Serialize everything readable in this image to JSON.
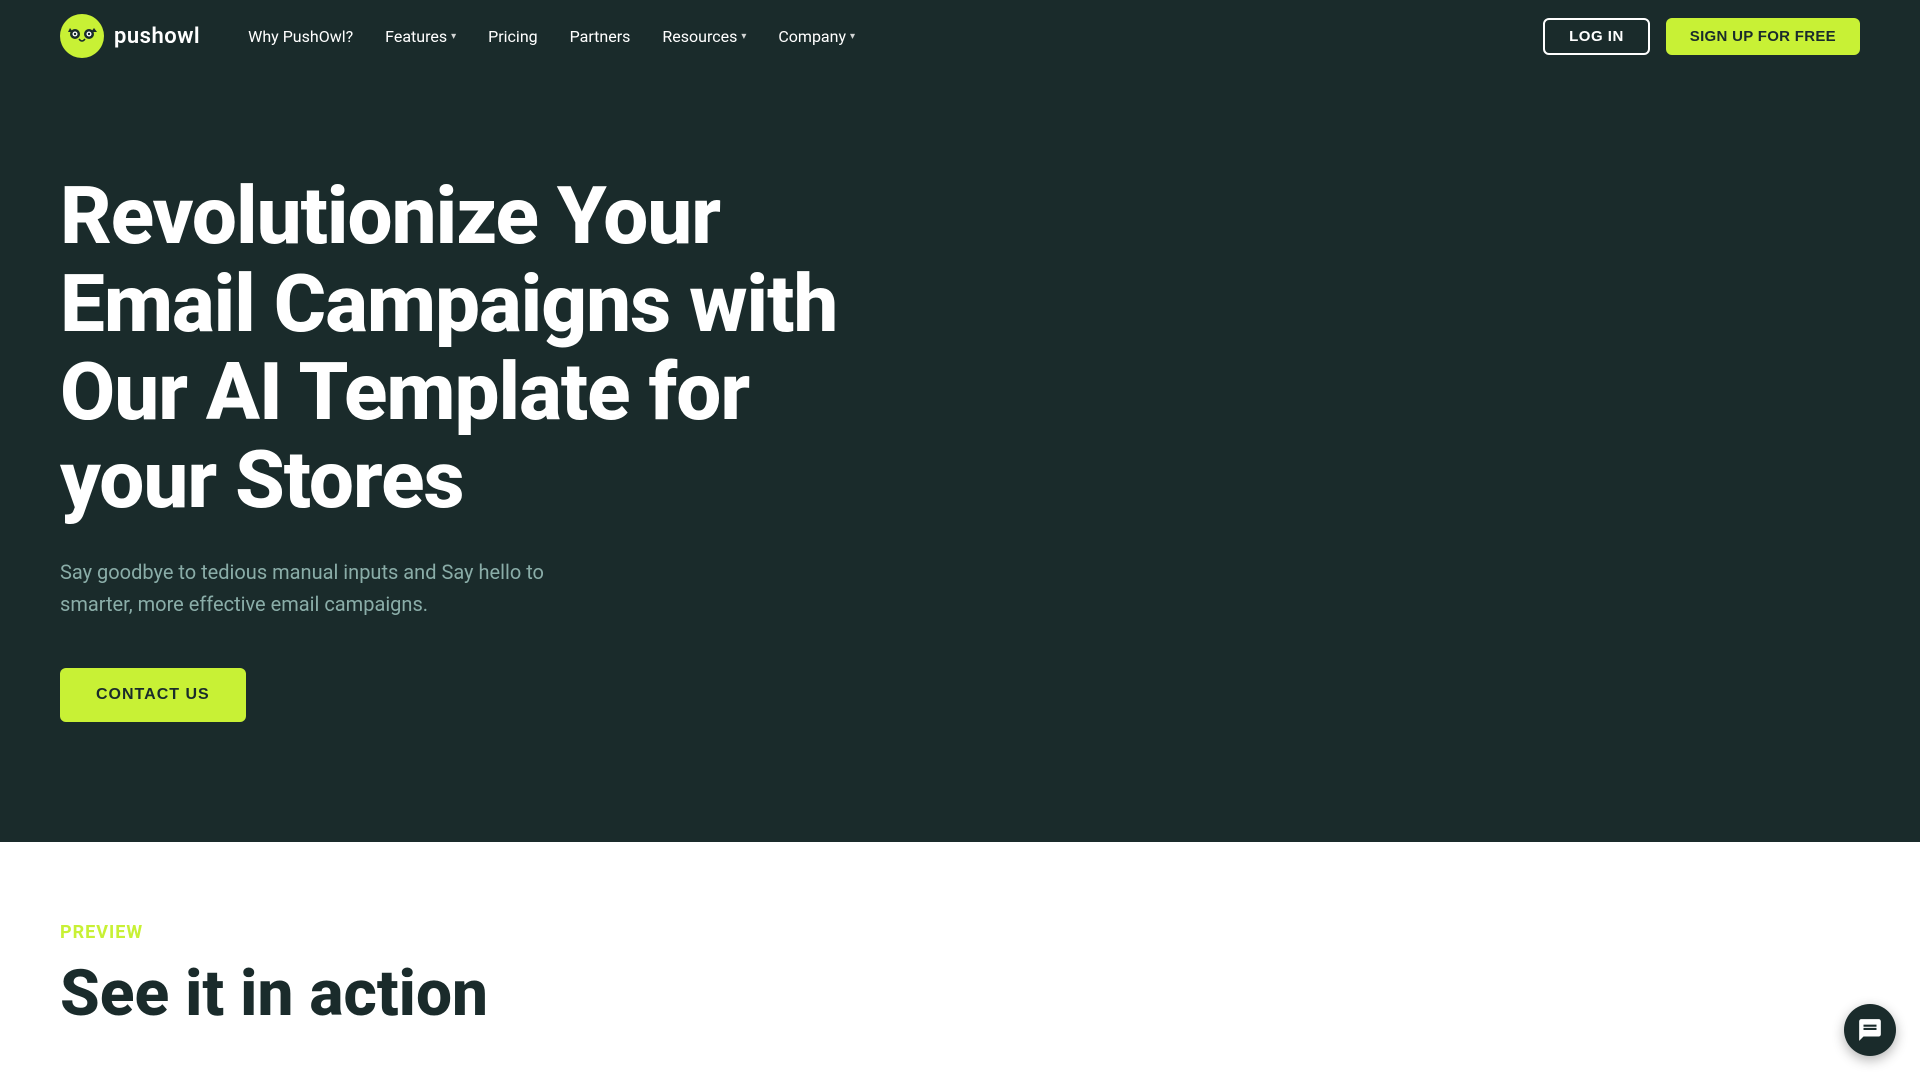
{
  "navbar": {
    "logo_text": "pushowl",
    "nav_items": [
      {
        "label": "Why PushOwl?",
        "has_dropdown": false
      },
      {
        "label": "Features",
        "has_dropdown": true
      },
      {
        "label": "Pricing",
        "has_dropdown": false
      },
      {
        "label": "Partners",
        "has_dropdown": false
      },
      {
        "label": "Resources",
        "has_dropdown": true
      },
      {
        "label": "Company",
        "has_dropdown": true
      }
    ],
    "login_label": "LOG IN",
    "signup_label": "SIGN UP FOR FREE"
  },
  "hero": {
    "title": "Revolutionize Your Email Campaigns with Our AI Template for your Stores",
    "subtitle": "Say goodbye to tedious manual inputs and Say hello to smarter, more effective email campaigns.",
    "cta_label": "CONTACT US"
  },
  "preview": {
    "section_label": "PREVIEW",
    "section_title": "See it in action"
  },
  "colors": {
    "dark_bg": "#1a2b2b",
    "accent": "#c8f135",
    "text_muted": "#8aada8"
  }
}
